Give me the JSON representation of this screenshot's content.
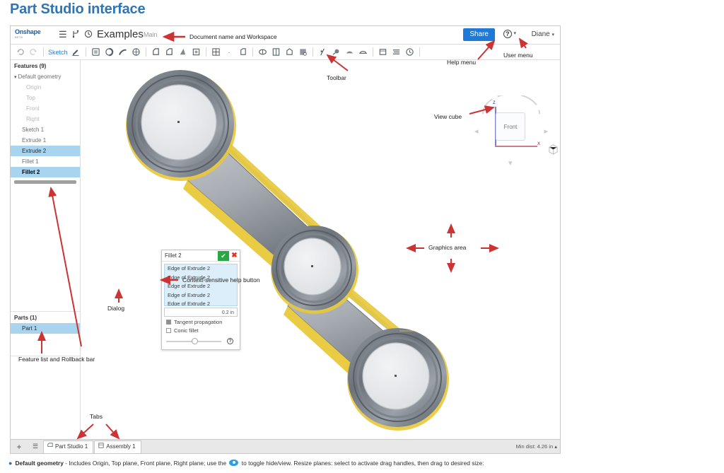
{
  "page": {
    "heading": "Part Studio interface"
  },
  "topbar": {
    "logo_main": "Onshape",
    "logo_beta": "BETA",
    "menu_icon": "hamburger-menu-icon",
    "branch_icon": "branch-icon",
    "history_icon": "history-clock-icon",
    "document_name": "Examples",
    "workspace_name": "Main",
    "share_label": "Share",
    "help_symbol": "?",
    "user_name": "Diane",
    "caret": "▾"
  },
  "toolbar": {
    "undo_icon": "undo-arrow-icon",
    "redo_icon": "redo-arrow-icon",
    "sketch_label": "Sketch",
    "tools": [
      "plane-icon",
      "helix-icon",
      "curve-icon",
      "point-icon",
      "extrude-icon",
      "revolve-icon",
      "sweep-icon",
      "loft-icon",
      "boolean-icon",
      "thicken-icon",
      "fillet-icon",
      "chamfer-icon",
      "draft-icon",
      "shell-icon",
      "split-icon",
      "move-face-icon",
      "transform-icon",
      "mirror-icon",
      "sheet-metal-icon",
      "pattern-icon",
      "measure-icon"
    ]
  },
  "features_panel": {
    "header": "Features (9)",
    "default_geometry": "Default geometry",
    "default_children": [
      "Origin",
      "Top",
      "Front",
      "Right"
    ],
    "items": [
      {
        "label": "Sketch 1",
        "state": "normal"
      },
      {
        "label": "Extrude 1",
        "state": "normal"
      },
      {
        "label": "Extrude 2",
        "state": "selected"
      },
      {
        "label": "Fillet 1",
        "state": "normal"
      },
      {
        "label": "Fillet 2",
        "state": "selected-bold"
      }
    ],
    "rollback_bar": "rollback-bar"
  },
  "parts_panel": {
    "header": "Parts (1)",
    "items": [
      {
        "label": "Part 1",
        "state": "selected"
      }
    ]
  },
  "dialog": {
    "title": "Fillet 2",
    "ok_glyph": "✔",
    "cancel_glyph": "✖",
    "edges": [
      "Edge of Extrude 2",
      "Edge of Extrude 2",
      "Edge of Extrude 2",
      "Edge of Extrude 2",
      "Edge of Extrude 2"
    ],
    "value": "0.2 in",
    "tangent_propagation_label": "Tangent propagation",
    "tangent_propagation_checked": true,
    "conic_fillet_label": "Conic fillet",
    "conic_fillet_checked": false,
    "help_symbol": "?"
  },
  "view_cube": {
    "face_label": "Front",
    "axis_z_label": "Z",
    "axis_x_label": "X",
    "arrow_left": "◂",
    "arrow_right": "▸",
    "arrow_down": "▾",
    "display_mode_icon": "display-mode-cube-icon"
  },
  "bottom_bar": {
    "add_tab_glyph": "+",
    "list_tabs_glyph": "☰",
    "tabs": [
      {
        "label": "Part Studio 1",
        "icon": "part-studio-icon"
      },
      {
        "label": "Assembly 1",
        "icon": "assembly-icon"
      }
    ],
    "status": "Min dist: 4.26 in  ▴"
  },
  "annotations": {
    "document_name": "Document name and Workspace",
    "toolbar": "Toolbar",
    "help_menu": "Help menu",
    "user_menu": "User menu",
    "view_cube": "View cube",
    "graphics_area": "Graphics area",
    "context_help": "Context-sensitive help button",
    "dialog": "Dialog",
    "feature_list": "Feature list and Rollback bar",
    "tabs": "Tabs"
  },
  "caption": {
    "bullet": "●",
    "term": "Default geometry",
    "text_before_icon": " - Includes Origin, Top plane, Front plane, Right plane; use the ",
    "icon_name": "eye-visibility-icon",
    "text_after_icon": " to toggle hide/view. Resize planes: select to activate drag handles, then drag to desired size:"
  },
  "colors": {
    "heading_blue": "#2e75b6",
    "share_blue": "#1e7ad6",
    "selection_blue": "#a8d4f0",
    "annotation_red": "#cc3333",
    "fillet_yellow": "#e8c83a",
    "part_gray": "#9aa0a6"
  }
}
